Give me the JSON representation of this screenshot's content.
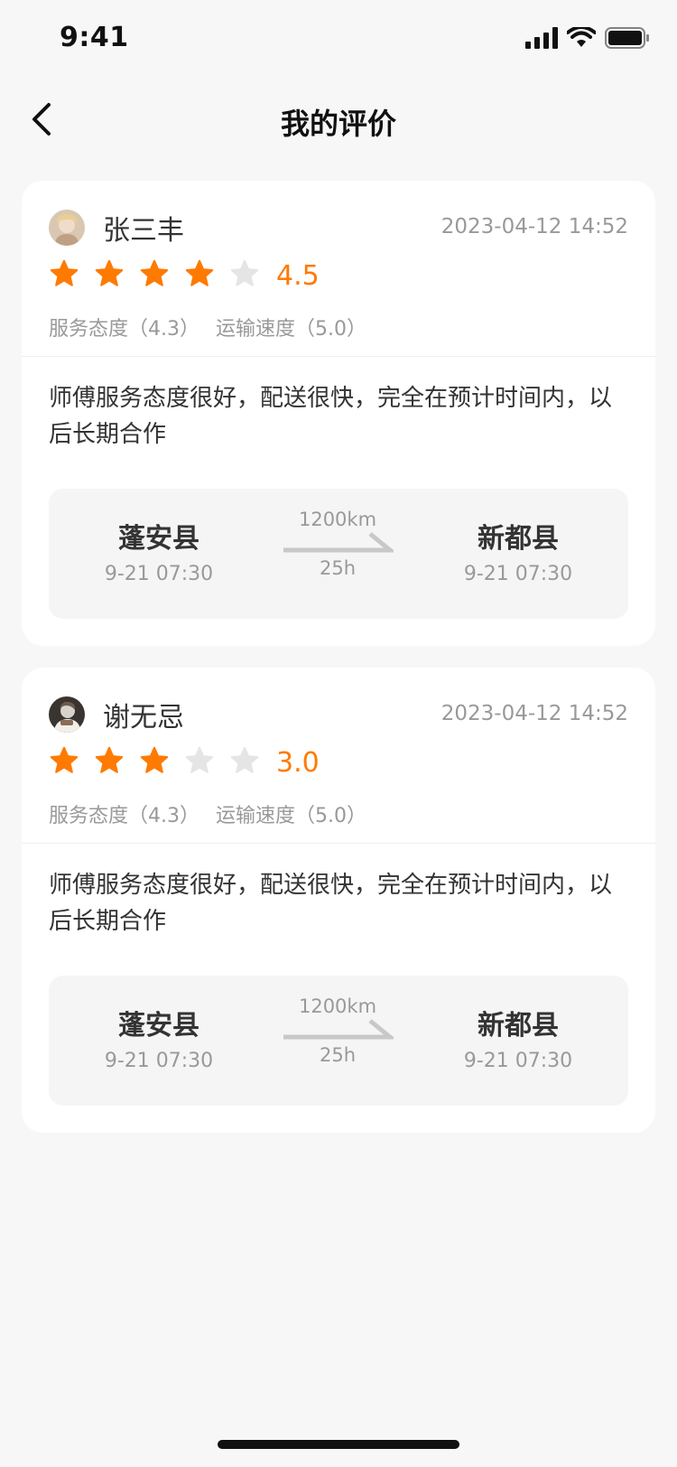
{
  "status_bar": {
    "time": "9:41"
  },
  "nav": {
    "title": "我的评价"
  },
  "colors": {
    "accent": "#ff7a00",
    "star_empty": "#e5e5e5",
    "background": "#f7f7f7"
  },
  "reviews": [
    {
      "user_name": "张三丰",
      "time": "2023-04-12 14:52",
      "rating": 4.5,
      "rating_text": "4.5",
      "filled_stars": 4,
      "service_attitude": "服务态度（4.3）",
      "transport_speed": "运输速度（5.0）",
      "comment": "师傅服务态度很好，配送很快，完全在预计时间内，以后长期合作",
      "route": {
        "from": "蓬安县",
        "from_time": "9-21 07:30",
        "distance": "1200km",
        "duration": "25h",
        "to": "新都县",
        "to_time": "9-21 07:30"
      }
    },
    {
      "user_name": "谢无忌",
      "time": "2023-04-12 14:52",
      "rating": 3.0,
      "rating_text": "3.0",
      "filled_stars": 3,
      "service_attitude": "服务态度（4.3）",
      "transport_speed": "运输速度（5.0）",
      "comment": "师傅服务态度很好，配送很快，完全在预计时间内，以后长期合作",
      "route": {
        "from": "蓬安县",
        "from_time": "9-21 07:30",
        "distance": "1200km",
        "duration": "25h",
        "to": "新都县",
        "to_time": "9-21 07:30"
      }
    }
  ]
}
